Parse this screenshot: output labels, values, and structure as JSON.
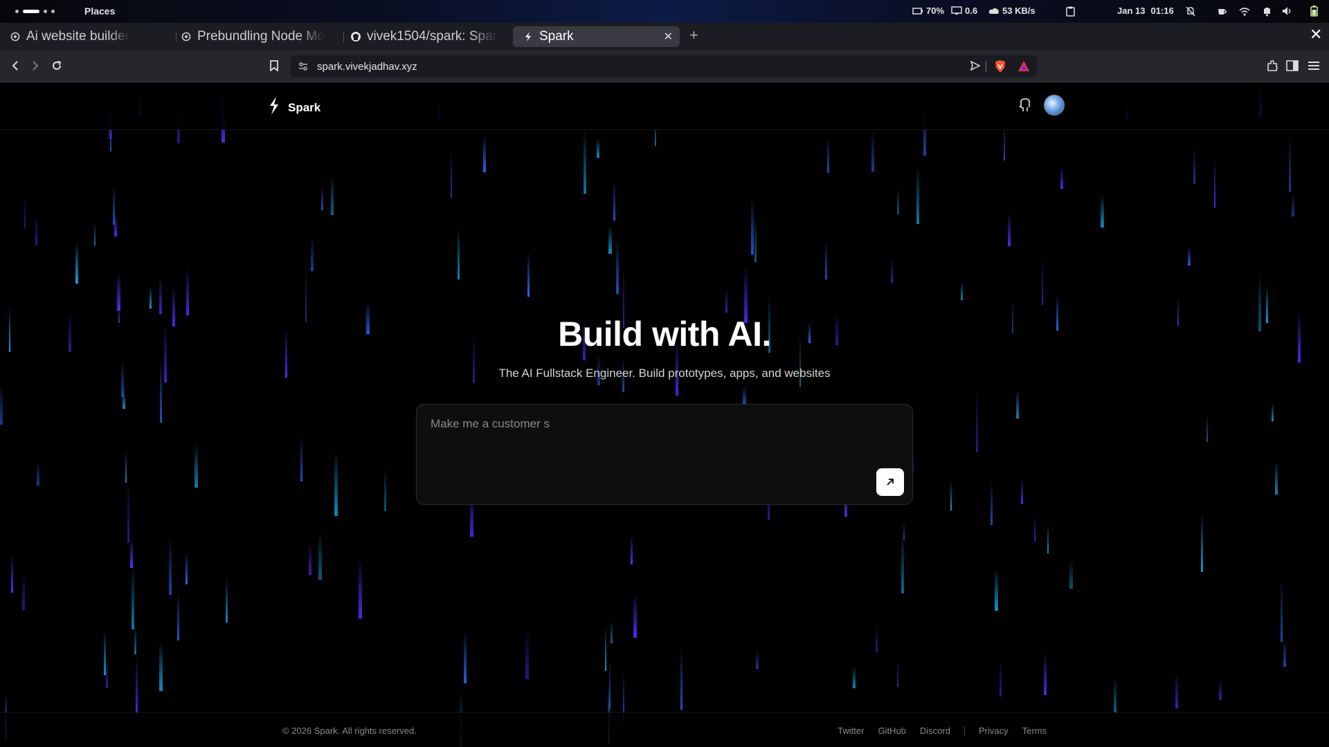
{
  "system_bar": {
    "places_label": "Places",
    "battery": "70%",
    "load": "0.6",
    "network": "53 KB/s",
    "date": "Jan 13",
    "time": "01:16"
  },
  "tabs": [
    {
      "label": "Ai website builder",
      "icon": "openai-icon"
    },
    {
      "label": "Prebundling Node Mo",
      "icon": "openai-icon"
    },
    {
      "label": "vivek1504/spark: Spar",
      "icon": "github-icon"
    },
    {
      "label": "Spark",
      "icon": "spark-icon",
      "active": true
    }
  ],
  "address_bar": {
    "url": "spark.vivekjadhav.xyz"
  },
  "site": {
    "brand": "Spark",
    "hero_title": "Build with AI.",
    "hero_subtitle": "The AI Fullstack Engineer. Build prototypes, apps, and websites",
    "prompt_value": "Make me a customer s",
    "footer_copyright": "© 2026 Spark. All rights reserved.",
    "footer_links": [
      "Twitter",
      "GitHub",
      "Discord"
    ],
    "footer_legal": [
      "Privacy",
      "Terms"
    ]
  },
  "colors": {
    "rain_blue": "#2f6bff",
    "rain_cyan": "#1aa7e8",
    "rain_violet": "#5a2bff",
    "background": "#000000"
  }
}
